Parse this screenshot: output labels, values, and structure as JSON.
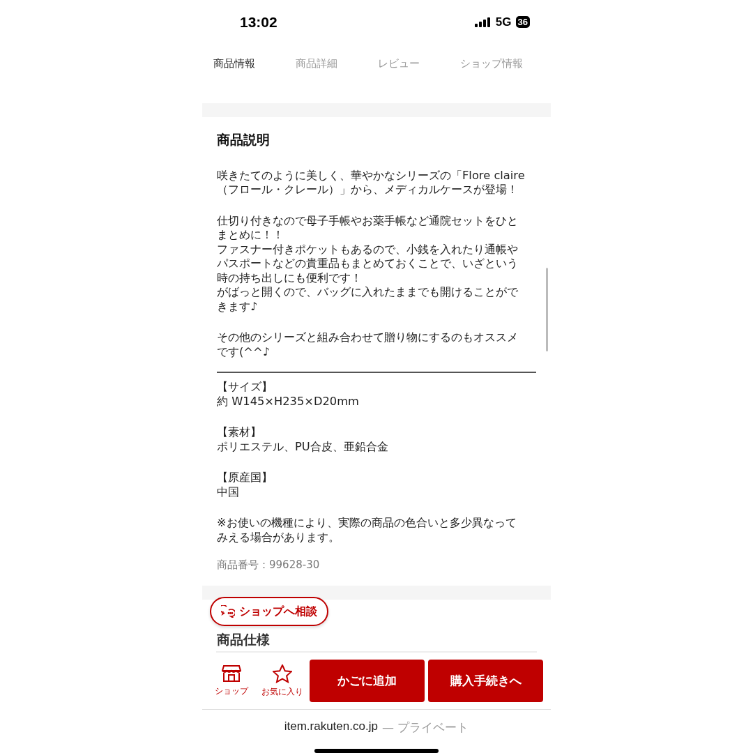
{
  "status_bar": {
    "time": "13:02",
    "network": "5G",
    "battery": "36"
  },
  "tabs": [
    {
      "label": "商品情報",
      "selected": true
    },
    {
      "label": "商品詳細",
      "selected": false
    },
    {
      "label": "レビュー",
      "selected": false
    },
    {
      "label": "ショップ情報",
      "selected": false
    }
  ],
  "description": {
    "heading": "商品説明",
    "paragraphs": [
      [
        "咲きたてのように美しく、華やかなシリーズの「Flore claire",
        "（フロール・クレール）」から、メディカルケースが登場！"
      ],
      [
        "仕切り付きなので母子手帳やお薬手帳など通院セットをひと",
        "まとめに！！",
        "ファスナー付きポケットもあるので、小銭を入れたり通帳や",
        "パスポートなどの貴重品もまとめておくことで、いざという",
        "時の持ち出しにも便利です！",
        "がばっと開くので、バッグに入れたままでも開けることがで",
        "きます♪"
      ],
      [
        "その他のシリーズと組み合わせて贈り物にするのもオススメ",
        "です(^^♪"
      ]
    ],
    "specs": [
      [
        "【サイズ】",
        "約 W145×H235×D20mm"
      ],
      [
        "【素材】",
        "ポリエステル、PU合皮、亜鉛合金"
      ],
      [
        "【原産国】",
        "中国"
      ],
      [
        "※お使いの機種により、実際の商品の色合いと多少異なって",
        "みえる場合があります。"
      ]
    ],
    "item_number": "商品番号：99628-30"
  },
  "spec_section": {
    "heading": "商品仕様"
  },
  "consult_button": "ショップへ相談",
  "bottom_bar": {
    "shop": "ショップ",
    "favorite": "お気に入り",
    "add_to_cart": "かごに追加",
    "checkout": "購入手続きへ"
  },
  "url_bar": {
    "domain": "item.rakuten.co.jp",
    "label": "— プライベート"
  }
}
